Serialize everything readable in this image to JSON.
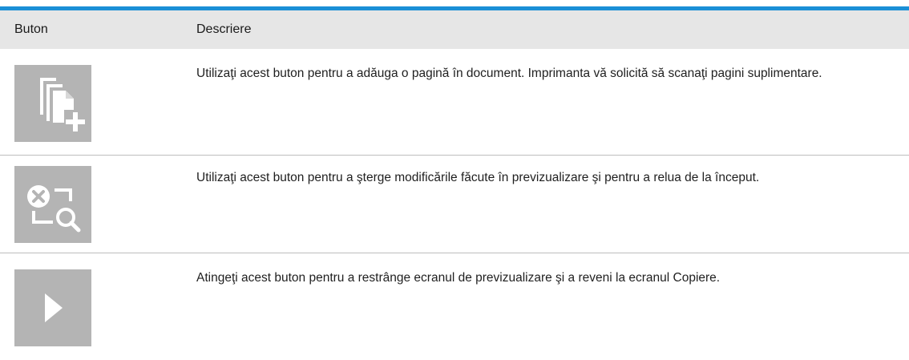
{
  "table": {
    "header": {
      "col_button": "Buton",
      "col_description": "Descriere"
    },
    "rows": [
      {
        "icon": "add-page-icon",
        "description": "Utilizaţi acest buton pentru a adăuga o pagină în document. Imprimanta vă solicită să scanaţi pagini suplimentare."
      },
      {
        "icon": "clear-preview-icon",
        "description": "Utilizaţi acest buton pentru a şterge modificările făcute în previzualizare şi pentru a relua de la început."
      },
      {
        "icon": "play-arrow-icon",
        "description": "Atingeţi acest buton pentru a restrânge ecranul de previzualizare şi a reveni la ecranul Copiere."
      }
    ]
  },
  "colors": {
    "accent_rule": "#1b8fd6",
    "header_bg": "#e6e6e6",
    "icon_tile_bg": "#b4b4b4",
    "icon_fg": "#ffffff"
  }
}
